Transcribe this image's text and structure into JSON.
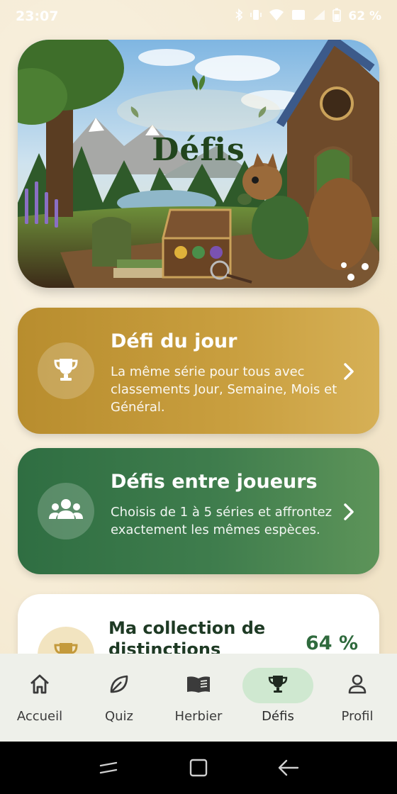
{
  "status_bar": {
    "time": "23:07",
    "battery": "62 %",
    "icons": [
      "bluetooth-icon",
      "vibrate-icon",
      "wifi-icon",
      "data-icon",
      "signal-icon",
      "battery-icon"
    ]
  },
  "hero": {
    "title": "Défis"
  },
  "cards": {
    "daily": {
      "title": "Défi du jour",
      "description": "La même série pour tous avec classements Jour, Semaine, Mois et Général.",
      "icon": "trophy-icon",
      "color": "#c49a3c"
    },
    "players": {
      "title": "Défis entre joueurs",
      "description": "Choisis de 1 à 5 séries et affrontez exactement les mêmes espèces.",
      "icon": "group-icon",
      "color": "#3f7d4d"
    }
  },
  "collection": {
    "title": "Ma collection de distinctions",
    "percent": "64 %",
    "icon": "trophy-icon"
  },
  "bottom_nav": {
    "items": [
      {
        "label": "Accueil",
        "icon": "home-icon"
      },
      {
        "label": "Quiz",
        "icon": "leaf-icon"
      },
      {
        "label": "Herbier",
        "icon": "book-icon"
      },
      {
        "label": "Défis",
        "icon": "trophy-icon",
        "active": true
      },
      {
        "label": "Profil",
        "icon": "person-icon"
      }
    ]
  },
  "system_nav": {
    "buttons": [
      "recents-icon",
      "home-square-icon",
      "back-icon"
    ]
  },
  "colors": {
    "background": "#f5ead2",
    "gold": "#c49a3c",
    "green": "#3f7d4d",
    "active_nav": "#cfe8d0"
  }
}
